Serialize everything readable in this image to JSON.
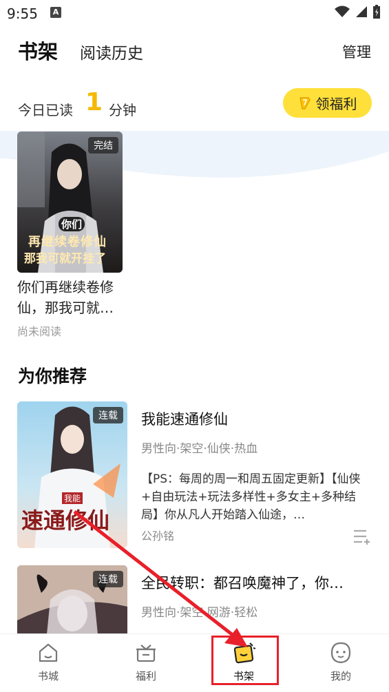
{
  "status_bar": {
    "time": "9:55",
    "notif": "A"
  },
  "header": {
    "tab_active": "书架",
    "tab_history": "阅读历史",
    "manage": "管理"
  },
  "reading": {
    "prefix": "今日已读",
    "minutes": "1",
    "unit": "分钟",
    "welfare_button": "领福利"
  },
  "shelf": {
    "book": {
      "tag": "完结",
      "title": "你们再继续卷修仙，那我可就…",
      "status": "尚未阅读",
      "cover_text_1": "你们",
      "cover_text_2": "再继续卷修仙",
      "cover_text_3": "那我可就开挂了"
    }
  },
  "recommend": {
    "heading": "为你推荐",
    "items": [
      {
        "tag": "连载",
        "title": "我能速通修仙",
        "genre": "男性向·架空·仙侠·热血",
        "desc": "【PS：每周的周一和周五固定更新】【仙侠+自由玩法+玩法多样性+多女主+多种结局】你从凡人开始踏入仙途，…",
        "author": "公孙铭",
        "cover_text": "速通修仙",
        "cover_small": "我能"
      },
      {
        "tag": "连载",
        "title": "全民转职：都召唤魔神了，你…",
        "genre": "男性向·架空·网游·轻松"
      }
    ]
  },
  "nav": {
    "items": [
      "书城",
      "福利",
      "书架",
      "我的"
    ]
  },
  "colors": {
    "accent": "#f5b800",
    "button": "#ffe03a",
    "highlight": "#e8202a"
  }
}
